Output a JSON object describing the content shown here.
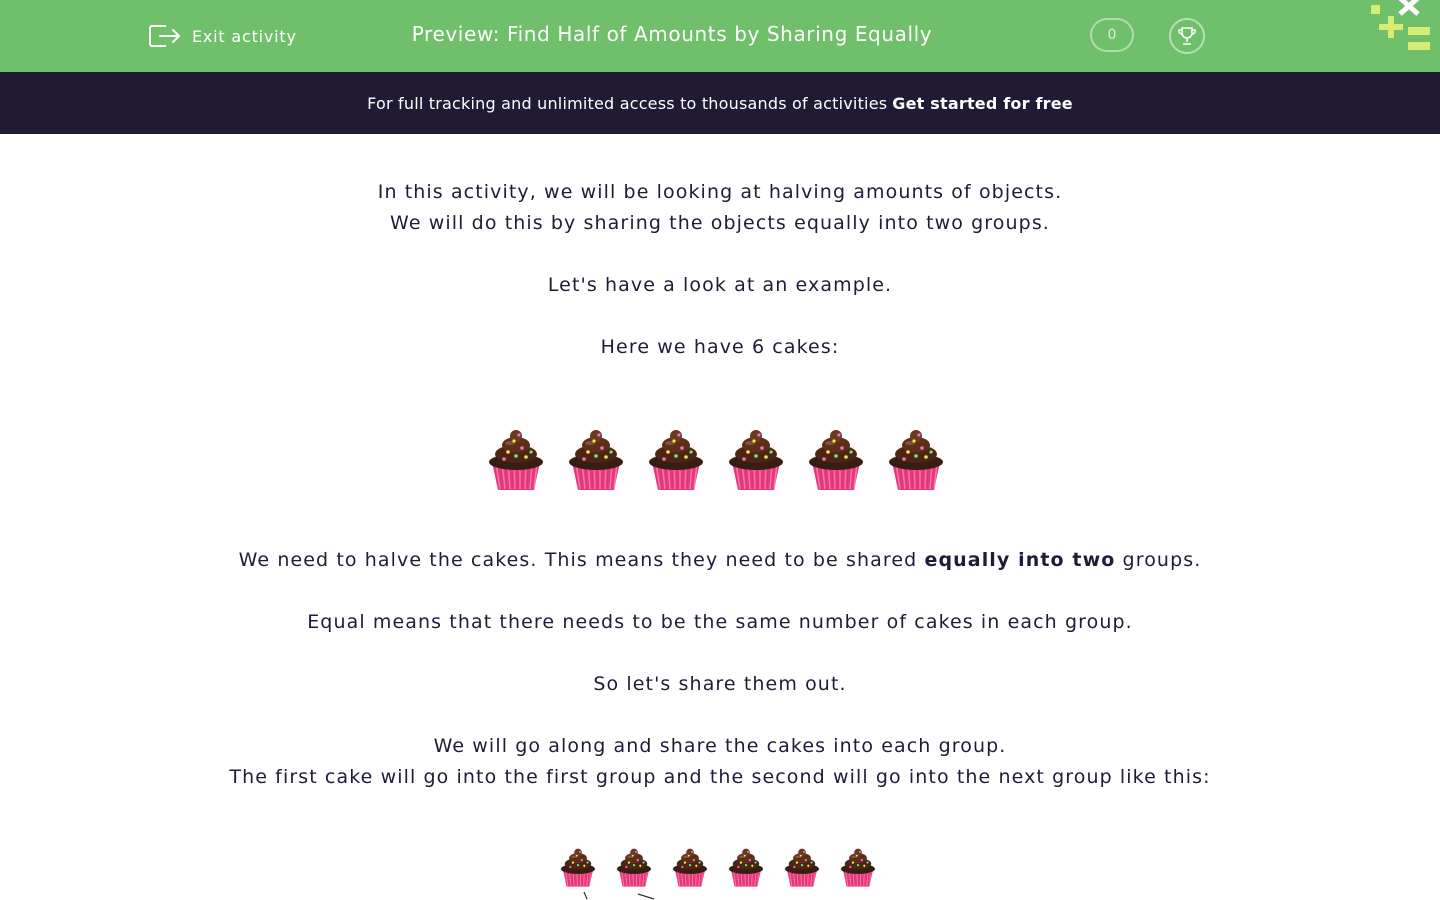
{
  "header": {
    "exit_label": "Exit activity",
    "title": "Preview: Find Half of Amounts by Sharing Equally",
    "score": "0",
    "bg_color": "#6fbf6b"
  },
  "banner": {
    "text": "For full tracking and unlimited access to thousands of activities",
    "cta": "Get started for free",
    "bg_color": "#211a34"
  },
  "content": {
    "intro_line1": "In this activity, we will be looking at halving amounts of objects.",
    "intro_line2": "We will do this by sharing the objects equally into two groups.",
    "example": "Let's have a look at an example.",
    "here": "Here we have 6 cakes:",
    "halve_pre": "We need to halve the cakes. This means they need to be shared ",
    "halve_bold": "equally into two",
    "halve_post": " groups.",
    "equal_means": "Equal means that there needs to be the same number of cakes in each group.",
    "share_out": "So let's share them out.",
    "go_along": "We will go along and share the cakes into each group.",
    "first_cake": "The first cake will go into the first group and the second will go into the next group like this:"
  },
  "icons": {
    "exit": "exit-icon",
    "trophy": "trophy-icon",
    "cake": "cupcake-icon"
  }
}
